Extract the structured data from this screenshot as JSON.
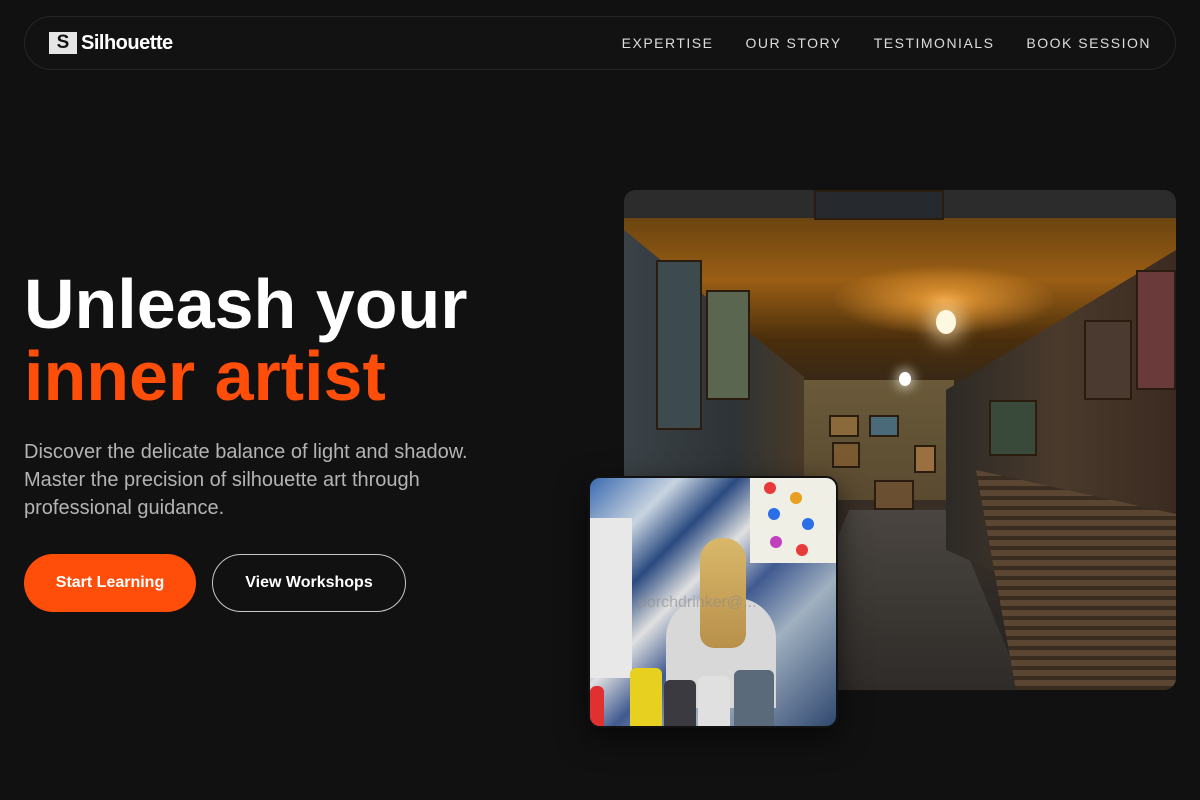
{
  "nav": {
    "logo_mark": "S",
    "logo_text": "Silhouette",
    "links": [
      "EXPERTISE",
      "OUR STORY",
      "TESTIMONIALS",
      "BOOK SESSION"
    ]
  },
  "hero": {
    "headline_line1": "Unleash your",
    "headline_line2": "inner artist",
    "subtitle": "Discover the delicate balance of light and shadow. Master the precision of silhouette art through professional guidance.",
    "primary_button": "Start Learning",
    "secondary_button": "View Workshops"
  },
  "images": {
    "main_photo": "art-studio-gallery-photo",
    "secondary_photo": "child-painting-photo",
    "secondary_watermark": "porchdrinker@..."
  },
  "colors": {
    "accent": "#ff4d0a",
    "background": "#111111",
    "text": "#ffffff",
    "muted_text": "#b4b4b4"
  }
}
